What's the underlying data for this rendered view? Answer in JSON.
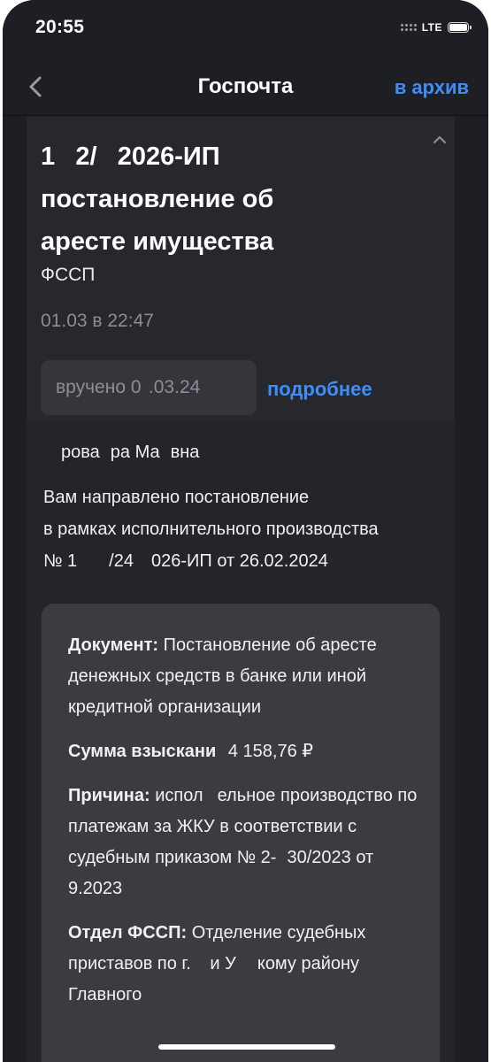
{
  "status_bar": {
    "time": "20:55",
    "network": "LTE",
    "signal_icon": "signal-dots-icon",
    "battery_icon": "battery-icon"
  },
  "nav": {
    "back_icon": "chevron-left-icon",
    "title": "Госпочта",
    "action_label": "в архив"
  },
  "letter": {
    "title_line1": "1    2/    2026-ИП",
    "title_line2": "постановление об",
    "title_line3": "аресте имущества",
    "sender": "ФССП",
    "date": "01.03 в 22:47",
    "delivery_status": "вручено 0  .03.24",
    "details_link": "подробнее",
    "collapse_icon": "chevron-up-icon"
  },
  "message": {
    "recipient": "     рова   ра Ма   вна",
    "intro_line1": "Вам направлено постановление",
    "intro_line2": "в рамках исполнительного производства",
    "intro_line3": "№ 1         /24     026-ИП от 26.02.2024"
  },
  "details": {
    "document_label": "Документ:",
    "document_text": "Постановление об аресте денежных средств в банке или иной кредитной организации",
    "amount_label": "Сумма взыскани",
    "amount_value": "  4 158,76 ₽",
    "reason_label": "Причина:",
    "reason_text": "испол    ельное производство по платежам за ЖКУ в соответствии с судебным приказом № 2-   30/2023 от     9.2023",
    "department_label": "Отдел ФССП:",
    "department_text": "Отделение судебных приставов по г.     и У      кому району Главного"
  },
  "colors": {
    "background": "#1d1f24",
    "card": "#26282d",
    "info_box": "#3a3c41",
    "accent": "#3f8ef5",
    "muted_text": "#8a8d93"
  }
}
